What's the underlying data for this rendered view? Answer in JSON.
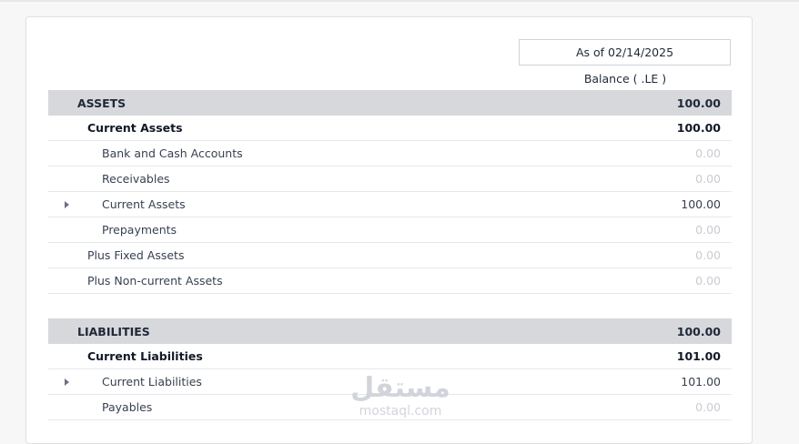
{
  "report": {
    "as_of": "As of 02/14/2025",
    "column_header": "Balance ( .LE )"
  },
  "assets": {
    "title": "ASSETS",
    "total": "100.00",
    "current_assets": {
      "label": "Current Assets",
      "total": "100.00"
    },
    "items": [
      {
        "label": "Bank and Cash Accounts",
        "amount": "0.00"
      },
      {
        "label": "Receivables",
        "amount": "0.00"
      },
      {
        "label": "Current Assets",
        "amount": "100.00"
      },
      {
        "label": "Prepayments",
        "amount": "0.00"
      }
    ],
    "plus_fixed": {
      "label": "Plus Fixed Assets",
      "amount": "0.00"
    },
    "plus_noncurrent": {
      "label": "Plus Non-current Assets",
      "amount": "0.00"
    }
  },
  "liabilities": {
    "title": "LIABILITIES",
    "total": "100.00",
    "current_liabilities": {
      "label": "Current Liabilities",
      "total": "101.00"
    },
    "items": [
      {
        "label": "Current Liabilities",
        "amount": "101.00"
      },
      {
        "label": "Payables",
        "amount": "0.00"
      }
    ]
  },
  "watermark": {
    "arabic": "مستقل",
    "latin": "mostaql.com"
  },
  "colors": {
    "section_bg": "#d6d8dc",
    "zero_text": "#c9ccd1",
    "card_border": "#e0e0e0"
  }
}
